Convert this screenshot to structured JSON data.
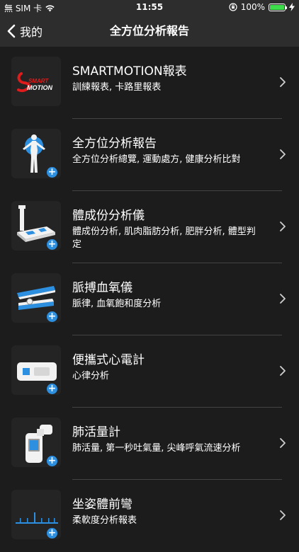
{
  "status_bar": {
    "carrier": "無 SIM 卡",
    "time": "11:55",
    "battery_percent": "100%",
    "battery_level": 1.0
  },
  "nav": {
    "back_label": "我的",
    "title": "全方位分析報告"
  },
  "items": [
    {
      "title": "SMARTMOTION報表",
      "subtitle": "訓練報表, 卡路里報表",
      "icon": "smartmotion-logo-icon",
      "logo_text_top": "SMART",
      "logo_text_bottom": "MOTION"
    },
    {
      "title": "全方位分析報告",
      "subtitle": "全方位分析總覽, 運動處方, 健康分析比對",
      "icon": "body-figure-icon"
    },
    {
      "title": "體成份分析儀",
      "subtitle": "體成份分析, 肌肉脂肪分析, 肥胖分析, 體型判定",
      "icon": "body-composition-scale-icon"
    },
    {
      "title": "脈搏血氧儀",
      "subtitle": "脈律, 血氧飽和度分析",
      "icon": "pulse-oximeter-icon"
    },
    {
      "title": "便攜式心電計",
      "subtitle": "心律分析",
      "icon": "portable-ecg-icon"
    },
    {
      "title": "肺活量計",
      "subtitle": "肺活量, 第一秒吐氣量, 尖峰呼氣流速分析",
      "icon": "spirometer-icon"
    },
    {
      "title": "坐姿體前彎",
      "subtitle": "柔軟度分析報表",
      "icon": "sit-and-reach-icon"
    }
  ]
}
